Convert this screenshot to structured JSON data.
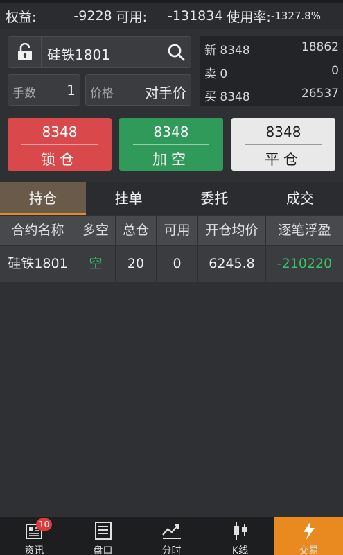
{
  "account": {
    "equity_label": "权益:",
    "equity_value": "-9228",
    "available_label": "可用:",
    "available_value": "-131834",
    "usage_label": "使用率:",
    "usage_value": "-1327.8%"
  },
  "order": {
    "symbol": "硅铁1801",
    "lots_label": "手数",
    "lots_value": "1",
    "price_label": "价格",
    "price_value": "对手价"
  },
  "quote": {
    "last_label": "新",
    "last_price": "8348",
    "last_volume": "18862",
    "ask_label": "卖",
    "ask_price": "0",
    "ask_volume": "0",
    "bid_label": "买",
    "bid_price": "8348",
    "bid_volume": "26537"
  },
  "actions": {
    "lock": {
      "price": "8348",
      "label": "锁仓"
    },
    "short": {
      "price": "8348",
      "label": "加空"
    },
    "close": {
      "price": "8348",
      "label": "平仓"
    }
  },
  "tabs": [
    "持仓",
    "挂单",
    "委托",
    "成交"
  ],
  "table": {
    "headers": [
      "合约名称",
      "多空",
      "总仓",
      "可用",
      "开仓均价",
      "逐笔浮盈"
    ],
    "rows": [
      [
        "硅铁1801",
        "空",
        "20",
        "0",
        "6245.8",
        "-210220"
      ]
    ]
  },
  "nav": {
    "items": [
      {
        "label": "资讯",
        "icon": "news-icon",
        "badge": "10"
      },
      {
        "label": "盘口",
        "icon": "orderbook-icon"
      },
      {
        "label": "分时",
        "icon": "timeshare-chart-icon"
      },
      {
        "label": "K线",
        "icon": "candlestick-icon"
      },
      {
        "label": "交易",
        "icon": "lightning-icon"
      }
    ]
  },
  "colors": {
    "lock_button": "#d9484a",
    "short_button": "#2f9a5a",
    "close_button": "#e9e9e9",
    "active_tab": "#e7892a",
    "active_nav": "#e98a21",
    "profit_negative": "#3cc46a"
  }
}
